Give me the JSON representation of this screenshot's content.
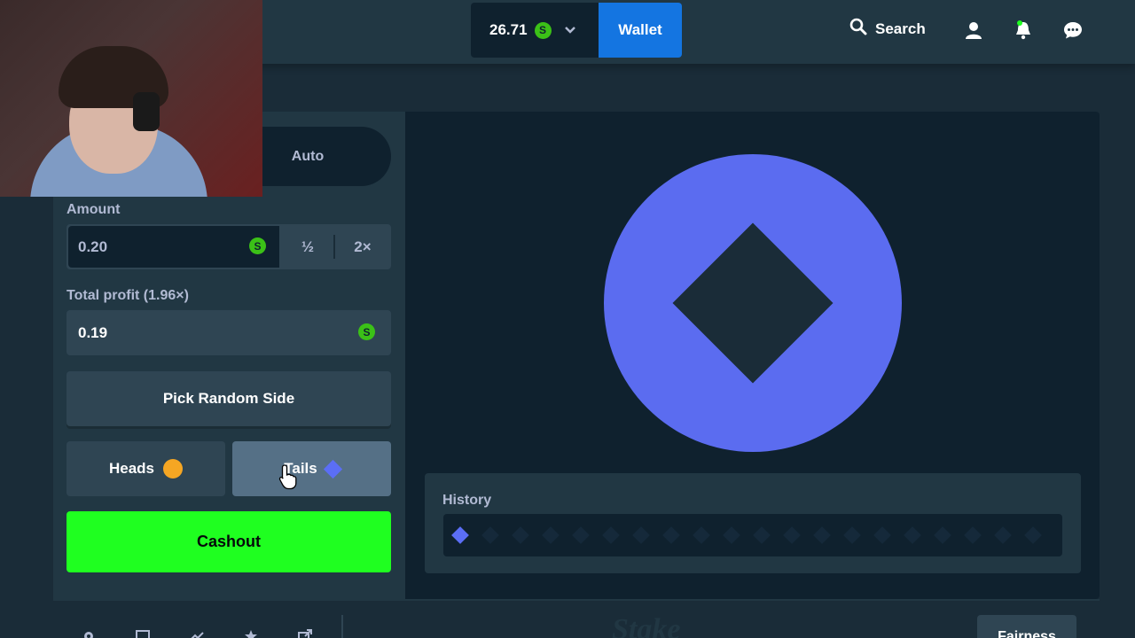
{
  "header": {
    "balance": "26.71",
    "currency_symbol": "S",
    "wallet_label": "Wallet",
    "search_label": "Search"
  },
  "bet_panel": {
    "tab_auto": "Auto",
    "amount_label": "Amount",
    "amount_value": "0.20",
    "half_label": "½",
    "double_label": "2×",
    "profit_label": "Total profit (1.96×)",
    "profit_value": "0.19",
    "random_label": "Pick Random Side",
    "heads_label": "Heads",
    "tails_label": "Tails",
    "cashout_label": "Cashout"
  },
  "game": {
    "coin_side": "tails",
    "history_label": "History",
    "history_filled_count": 1,
    "history_slots": 20
  },
  "footer": {
    "fairness_label": "Fairness",
    "logo_text": "Stake"
  },
  "colors": {
    "accent_green": "#1fff20",
    "wallet_blue": "#1475e1",
    "tails_blue": "#5b6cf0",
    "heads_orange": "#f5a623",
    "coin_green": "#3bc117"
  }
}
